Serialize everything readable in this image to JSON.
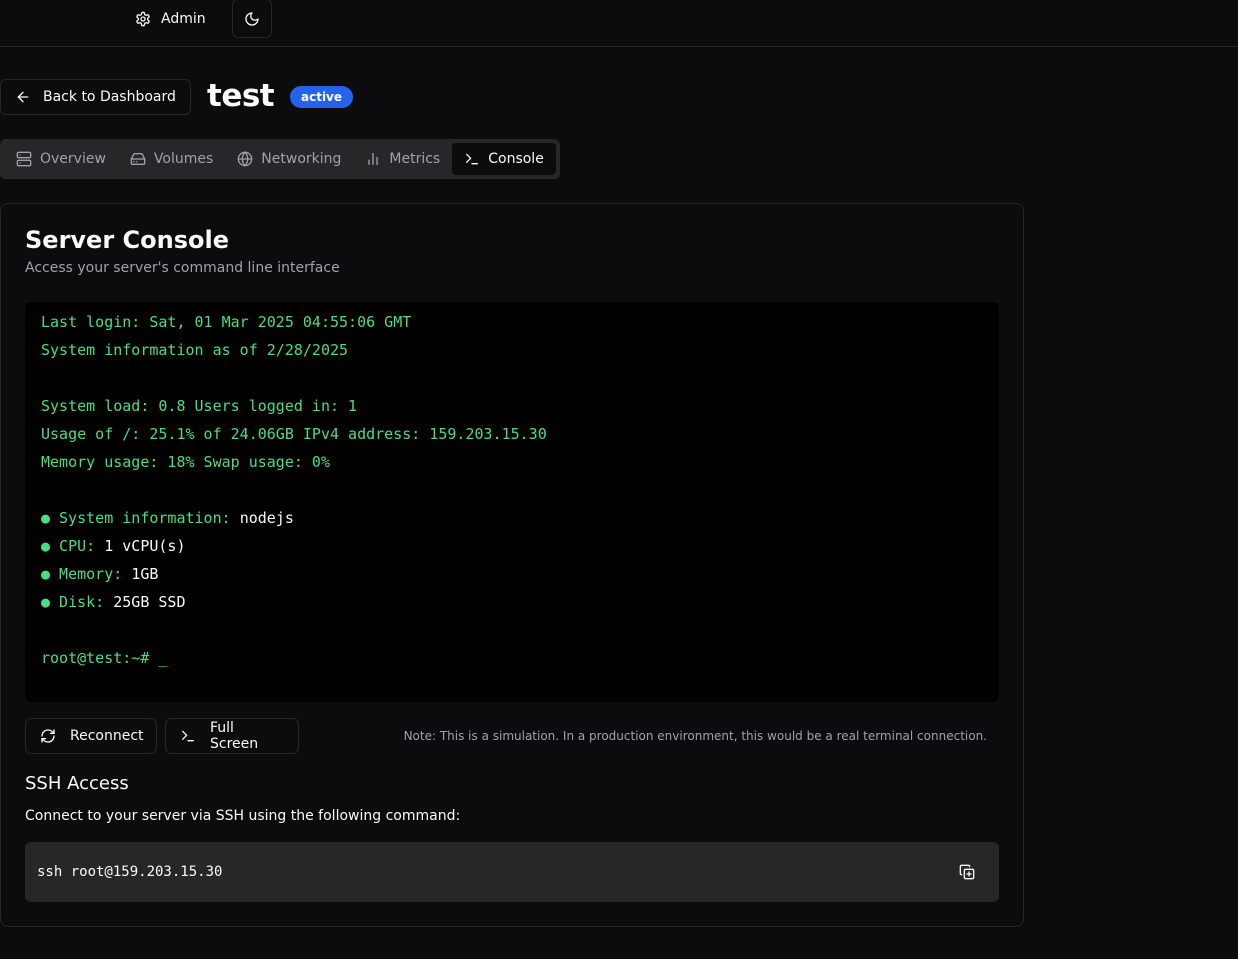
{
  "header": {
    "admin_label": "Admin",
    "admin_icon": "gear-icon",
    "theme_icon": "moon-icon"
  },
  "server": {
    "back_label": "Back to Dashboard",
    "name": "test",
    "status": "active"
  },
  "tabs": [
    {
      "label": "Overview",
      "icon": "server-icon",
      "active": false
    },
    {
      "label": "Volumes",
      "icon": "hard-drive-icon",
      "active": false
    },
    {
      "label": "Networking",
      "icon": "globe-icon",
      "active": false
    },
    {
      "label": "Metrics",
      "icon": "bar-chart-icon",
      "active": false
    },
    {
      "label": "Console",
      "icon": "terminal-icon",
      "active": true
    }
  ],
  "console": {
    "title": "Server Console",
    "subtitle": "Access your server's command line interface",
    "lines": {
      "l1": "Last login: Sat, 01 Mar 2025 04:55:06 GMT",
      "l2": "System information as of 2/28/2025",
      "l3": "System load: 0.8 Users logged in: 1",
      "l4": "Usage of /: 25.1% of 24.06GB IPv4 address: 159.203.15.30",
      "l5": "Memory usage: 18% Swap usage: 0%"
    },
    "specs": [
      {
        "label": "● System information: ",
        "value": "nodejs"
      },
      {
        "label": "● CPU: ",
        "value": "1 vCPU(s)"
      },
      {
        "label": "● Memory: ",
        "value": "1GB"
      },
      {
        "label": "● Disk: ",
        "value": "25GB SSD"
      }
    ],
    "prompt": "root@test:~# _",
    "reconnect_label": "Reconnect",
    "fullscreen_label": "Full Screen",
    "note": "Note: This is a simulation. In a production environment, this would be a real terminal connection."
  },
  "ssh": {
    "title": "SSH Access",
    "description": "Connect to your server via SSH using the following command:",
    "command": "ssh root@159.203.15.30",
    "copy_icon": "copy-icon"
  },
  "colors": {
    "background": "#0c0c0e",
    "border": "#27272a",
    "accent": "#2563eb",
    "terminal_text": "#4ade80"
  }
}
